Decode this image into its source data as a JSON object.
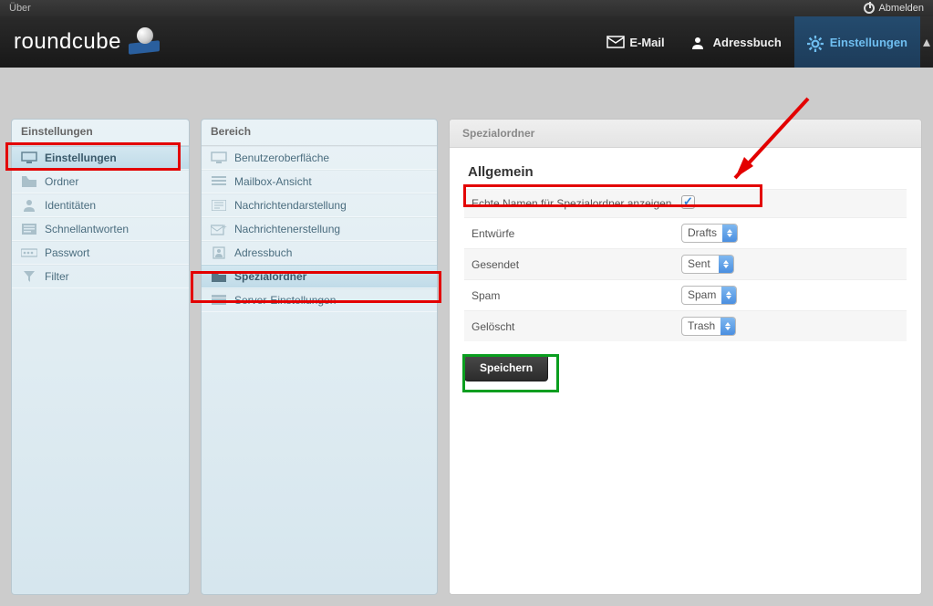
{
  "topstrip": {
    "about": "Über",
    "logout": "Abmelden"
  },
  "app_name": "roundcube",
  "topnav": {
    "mail": "E-Mail",
    "addressbook": "Adressbuch",
    "settings": "Einstellungen"
  },
  "panels": {
    "settings_title": "Einstellungen",
    "sections_title": "Bereich",
    "content_title": "Spezialordner"
  },
  "settings_list": [
    {
      "key": "einstellungen",
      "label": "Einstellungen"
    },
    {
      "key": "ordner",
      "label": "Ordner"
    },
    {
      "key": "identitaeten",
      "label": "Identitäten"
    },
    {
      "key": "schnellantworten",
      "label": "Schnellantworten"
    },
    {
      "key": "passwort",
      "label": "Passwort"
    },
    {
      "key": "filter",
      "label": "Filter"
    }
  ],
  "sections_list": [
    {
      "key": "ui",
      "label": "Benutzeroberfläche"
    },
    {
      "key": "mailbox",
      "label": "Mailbox-Ansicht"
    },
    {
      "key": "msgdisplay",
      "label": "Nachrichtendarstellung"
    },
    {
      "key": "msgcompose",
      "label": "Nachrichtenerstellung"
    },
    {
      "key": "addressbook",
      "label": "Adressbuch"
    },
    {
      "key": "specialfolders",
      "label": "Spezialordner"
    },
    {
      "key": "server",
      "label": "Server-Einstellungen"
    }
  ],
  "form": {
    "section_heading": "Allgemein",
    "real_names_label": "Echte Namen für Spezialordner anzeigen",
    "real_names_checked": true,
    "rows": {
      "drafts": {
        "label": "Entwürfe",
        "value": "Drafts"
      },
      "sent": {
        "label": "Gesendet",
        "value": "Sent"
      },
      "spam": {
        "label": "Spam",
        "value": "Spam"
      },
      "trash": {
        "label": "Gelöscht",
        "value": "Trash"
      }
    },
    "save_label": "Speichern"
  }
}
